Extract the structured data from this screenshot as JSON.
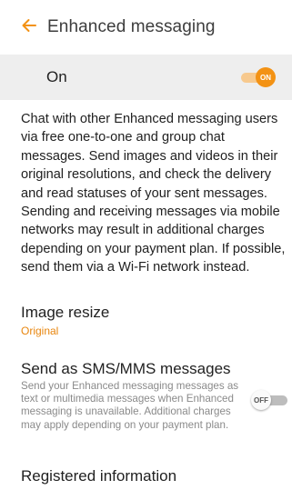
{
  "header": {
    "title": "Enhanced messaging",
    "back_icon": "arrow-left-icon",
    "accent_color": "#f39214"
  },
  "master_switch": {
    "label": "On",
    "state_label": "ON",
    "enabled": true
  },
  "description": "Chat with other Enhanced messaging users via free one-to-one and group chat messages. Send images and videos in their original resolutions, and check the delivery and read statuses of your sent messages. Sending and receiving messages via mobile networks may result in additional charges depending on your payment plan. If possible, send them via a Wi-Fi network instead.",
  "settings": {
    "image_resize": {
      "title": "Image resize",
      "value": "Original"
    },
    "send_as_sms": {
      "title": "Send as SMS/MMS messages",
      "description": "Send your Enhanced messaging messages as text or multimedia messages when Enhanced messaging is unavailable. Additional charges may apply depending on your payment plan.",
      "state_label": "OFF",
      "enabled": false
    },
    "registered_info": {
      "title": "Registered information"
    }
  }
}
